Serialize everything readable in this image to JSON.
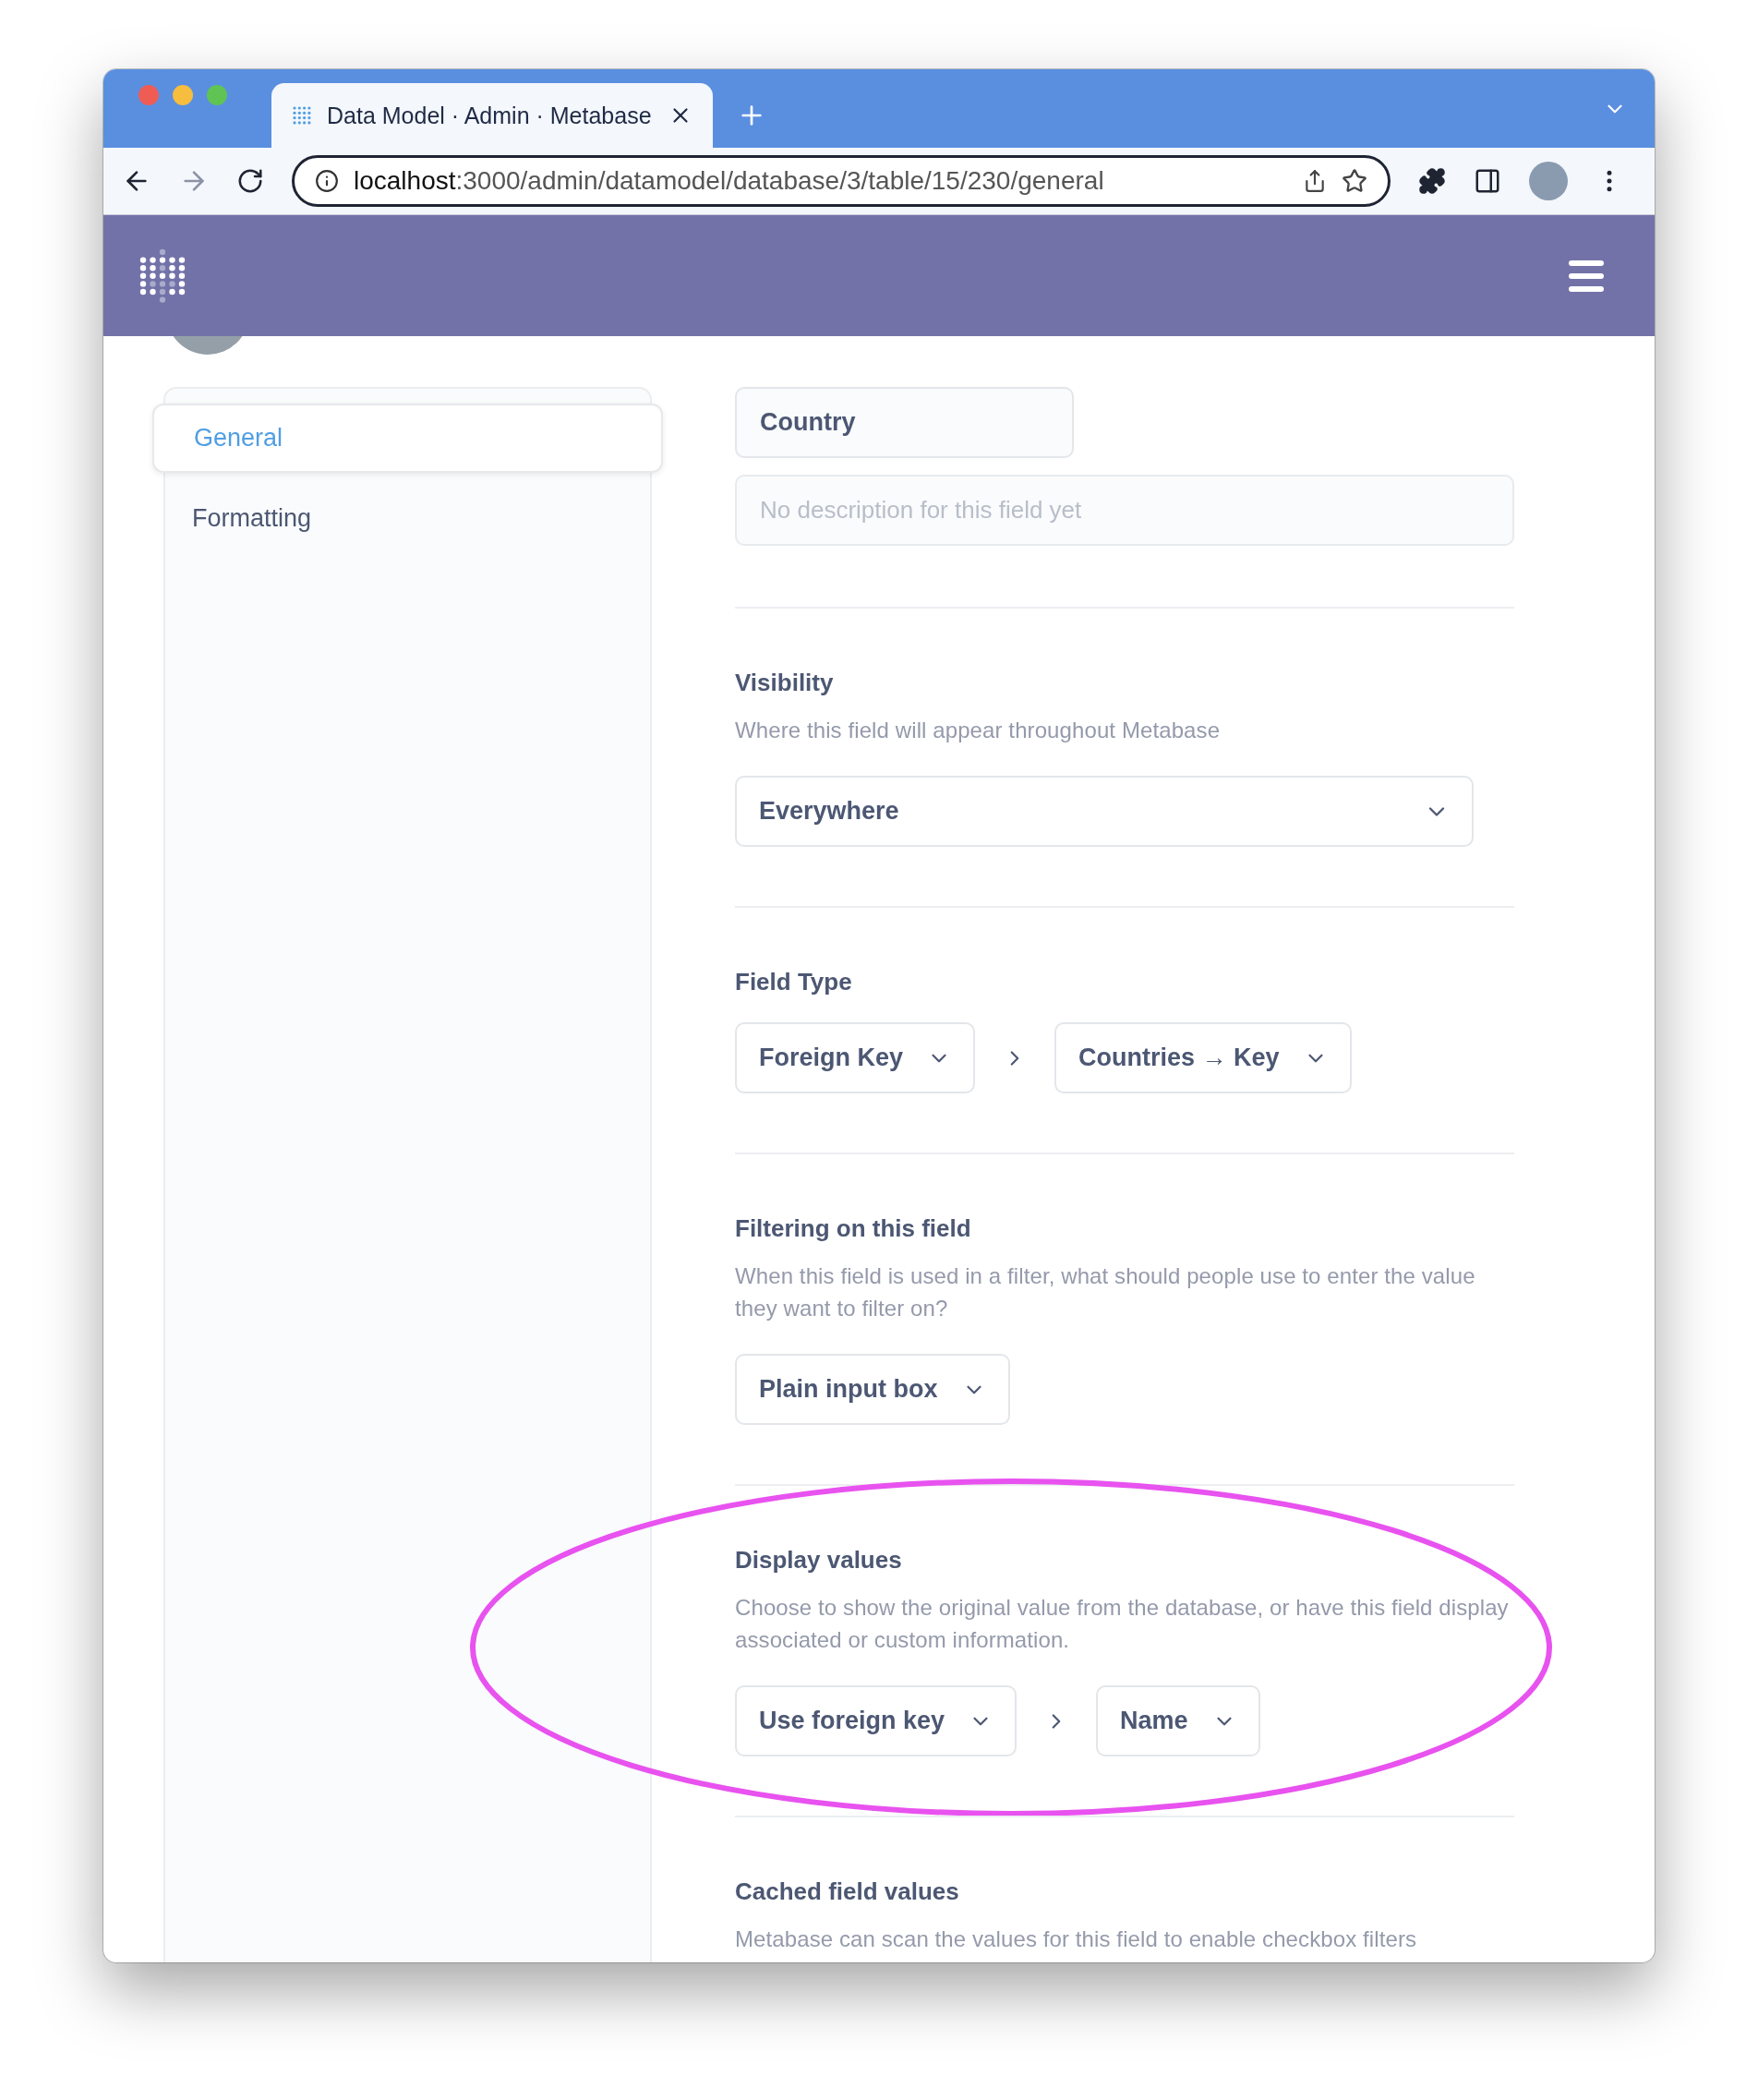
{
  "browser": {
    "tab_title": "Data Model · Admin · Metabase",
    "url_host": "localhost",
    "url_path": ":3000/admin/datamodel/database/3/table/15/230/general"
  },
  "sidebar": {
    "items": [
      {
        "label": "General",
        "selected": true
      },
      {
        "label": "Formatting",
        "selected": false
      }
    ]
  },
  "field": {
    "name_value": "Country",
    "description_placeholder": "No description for this field yet"
  },
  "sections": [
    {
      "kind": "wide",
      "title": "Visibility",
      "description": "Where this field will appear throughout Metabase",
      "selects": [
        "Everywhere"
      ],
      "highlighted": false
    },
    {
      "kind": "chain",
      "title": "Field Type",
      "selects": [
        "Foreign Key",
        "Countries → Key"
      ],
      "highlighted": false
    },
    {
      "kind": "chain",
      "title": "Filtering on this field",
      "description": "When this field is used in a filter, what should people use to enter the value they want to filter on?",
      "selects": [
        "Plain input box"
      ],
      "highlighted": false
    },
    {
      "kind": "chain",
      "title": "Display values",
      "description": "Choose to show the original value from the database, or have this field display associated or custom information.",
      "selects": [
        "Use foreign key",
        "Name"
      ],
      "highlighted": true
    },
    {
      "kind": "text",
      "title": "Cached field values",
      "description": "Metabase can scan the values for this field to enable checkbox filters",
      "highlighted": false
    }
  ]
}
